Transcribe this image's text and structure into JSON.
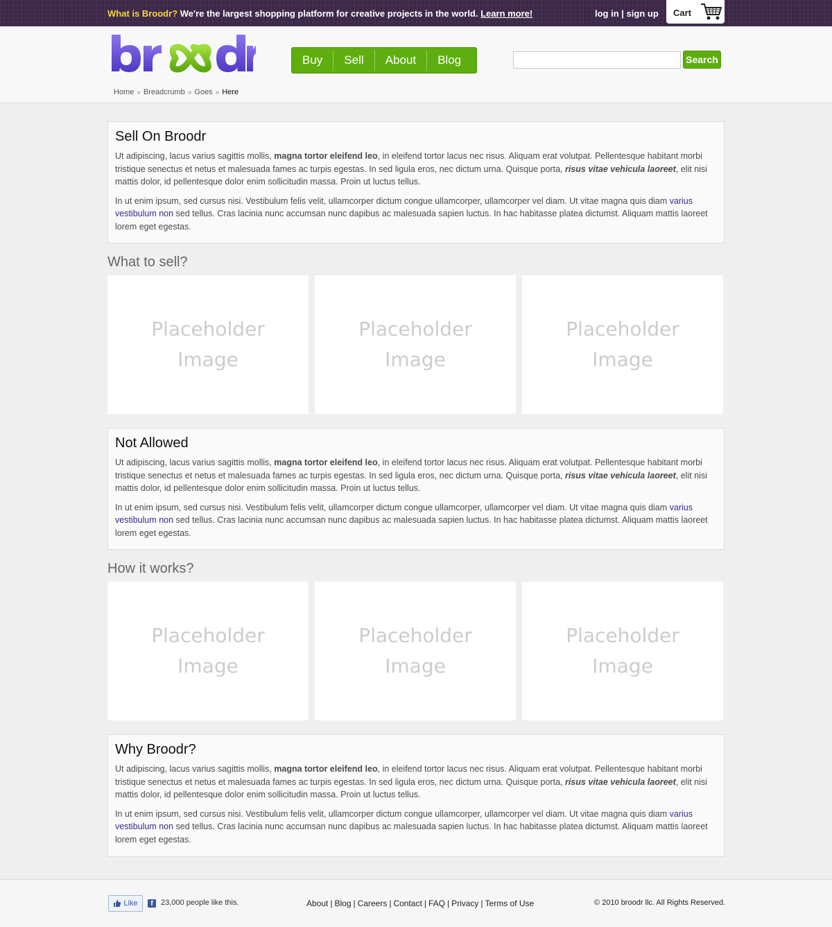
{
  "topbar": {
    "question": "What is Broodr?",
    "message": " We're the largest shopping platform for creative projects in the world. ",
    "learn_more": "Learn more!",
    "login": "log in",
    "separator": " | ",
    "signup": "sign up",
    "cart_label": "Cart"
  },
  "header": {
    "logo_text": "broodr",
    "nav": [
      "Buy",
      "Sell",
      "About",
      "Blog"
    ],
    "search_value": "",
    "search_button": "Search",
    "breadcrumb": [
      "Home",
      "Breadcrumb",
      "Goes",
      "Here"
    ],
    "breadcrumb_sep": "»"
  },
  "para": {
    "p1_a": "Ut adipiscing, lacus varius sagittis mollis, ",
    "p1_b": "magna tortor eleifend leo",
    "p1_c": ", in eleifend tortor lacus nec risus. Aliquam erat volutpat. Pellentesque habitant morbi tristique senectus et netus et malesuada fames ac turpis egestas. In sed ligula eros, nec dictum urna. Quisque porta, ",
    "p1_d": "risus vitae vehicula laoreet",
    "p1_e": ", elit nisi mattis dolor, id pellentesque dolor enim sollicitudin massa. Proin ut luctus tellus.",
    "p2_a": "In ut enim ipsum, sed cursus nisi. Vestibulum felis velit, ullamcorper dictum congue ullamcorper, ullamcorper vel diam. Ut vitae magna quis diam ",
    "p2_b": "varius vestibulum non",
    "p2_c": " sed tellus. Cras lacinia nunc accumsan nunc dapibus ac malesuada sapien luctus. In hac habitasse platea dictumst. Aliquam mattis laoreet lorem eget egestas."
  },
  "sections": {
    "sell_title": "Sell On Broodr",
    "what_title": "What to sell?",
    "not_allowed_title": "Not Allowed",
    "how_title": "How it works?",
    "why_title": "Why Broodr?"
  },
  "placeholder": {
    "line1": "Placeholder",
    "line2": "Image"
  },
  "footer": {
    "like_label": "Like",
    "like_count": "23,000 people like this.",
    "links": [
      "About",
      "Blog",
      "Careers",
      "Contact",
      "FAQ",
      "Privacy",
      "Terms of Use"
    ],
    "link_sep": "|",
    "copyright": "© 2010 broodr llc. All Rights Reserved."
  },
  "colors": {
    "topbar_bg": "#3f2a4b",
    "accent_green": "#5fae10",
    "logo_purple": "#6b4fd8",
    "logo_green": "#7cc21f",
    "highlight_yellow": "#f4d53a",
    "link_purple": "#3a2a8a"
  },
  "icons": [
    "shopping-cart-icon",
    "facebook-icon",
    "thumbs-up-icon"
  ]
}
